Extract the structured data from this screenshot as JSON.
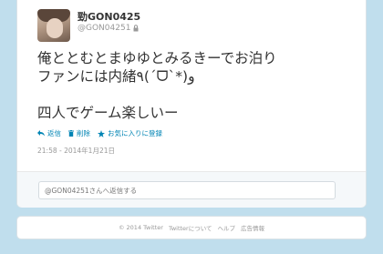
{
  "user": {
    "display_name": "勁GON0425",
    "handle": "@GON04251"
  },
  "tweet": {
    "line1": "俺ととむとまゆゆとみるきーでお泊り",
    "line2": "ファンには内緒٩(ˊᗜˋ*)و",
    "line3": "四人でゲーム楽しいー",
    "timestamp": "21:58 - 2014年1月21日"
  },
  "actions": {
    "reply": "返信",
    "delete": "削除",
    "favorite": "お気に入りに登録"
  },
  "reply_box": {
    "placeholder": "@GON04251さんへ返信する"
  },
  "footer": {
    "copyright": "© 2014 Twitter",
    "about": "Twitterについて",
    "help": "ヘルプ",
    "ads": "広告情報"
  },
  "colors": {
    "background": "#c0deed",
    "link": "#0084b4",
    "muted": "#999999"
  }
}
